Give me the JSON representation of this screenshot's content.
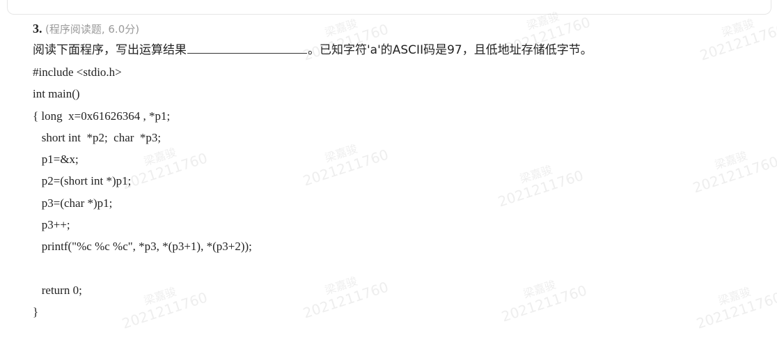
{
  "question": {
    "number": "3.",
    "meta": "(程序阅读题, 6.0分)",
    "text_before": "阅读下面程序，写出运算结果",
    "text_after": "。已知字符'a'的ASCII码是97，且低地址存储低字节。",
    "code": [
      "#include <stdio.h>",
      "int main()",
      "{ long  x=0x61626364 , *p1;",
      "   short int  *p2;  char  *p3;",
      "   p1=&x;",
      "   p2=(short int *)p1;",
      "   p3=(char *)p1;",
      "   p3++;",
      "   printf(\"%c %c %c\", *p3, *(p3+1), *(p3+2));",
      "",
      "   return 0;",
      "}"
    ]
  },
  "watermark": {
    "name": "梁嘉骏",
    "id": "2021211760"
  }
}
